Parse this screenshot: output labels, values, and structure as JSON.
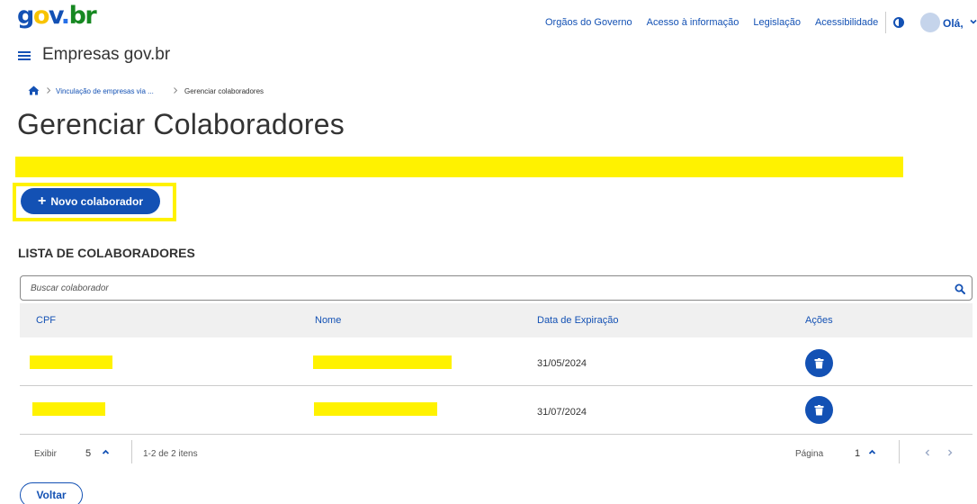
{
  "header": {
    "logo": [
      "g",
      "o",
      "v",
      ".",
      "br"
    ],
    "nav_links": [
      "Orgãos do Governo",
      "Acesso à informação",
      "Legislação",
      "Acessibilidade"
    ],
    "greeting": "Olá,",
    "app_title": "Empresas gov.br"
  },
  "breadcrumb": {
    "items": [
      "Vinculação de empresas via ...",
      "Gerenciar colaboradores"
    ]
  },
  "page": {
    "title": "Gerenciar Colaboradores",
    "new_button_label": "Novo colaborador",
    "section_title": "LISTA DE COLABORADORES",
    "back_button_label": "Voltar"
  },
  "search": {
    "placeholder": "Buscar colaborador"
  },
  "table": {
    "columns": [
      "CPF",
      "Nome",
      "Data de Expiração",
      "Ações"
    ],
    "rows": [
      {
        "expiration": "31/05/2024"
      },
      {
        "expiration": "31/07/2024"
      }
    ]
  },
  "pagination": {
    "show_label": "Exibir",
    "per_page": "5",
    "range_label": "1-2 de 2 itens",
    "page_label": "Página",
    "current_page": "1"
  },
  "colors": {
    "primary": "#1351b4",
    "highlight": "#fff200",
    "header_row": "#f0f0f0",
    "text": "#333333"
  },
  "icons": [
    "menu-icon",
    "home-icon",
    "contrast-icon",
    "search-icon",
    "trash-icon",
    "chevron-up-icon",
    "chevron-left-icon",
    "chevron-right-icon",
    "plus-icon"
  ]
}
